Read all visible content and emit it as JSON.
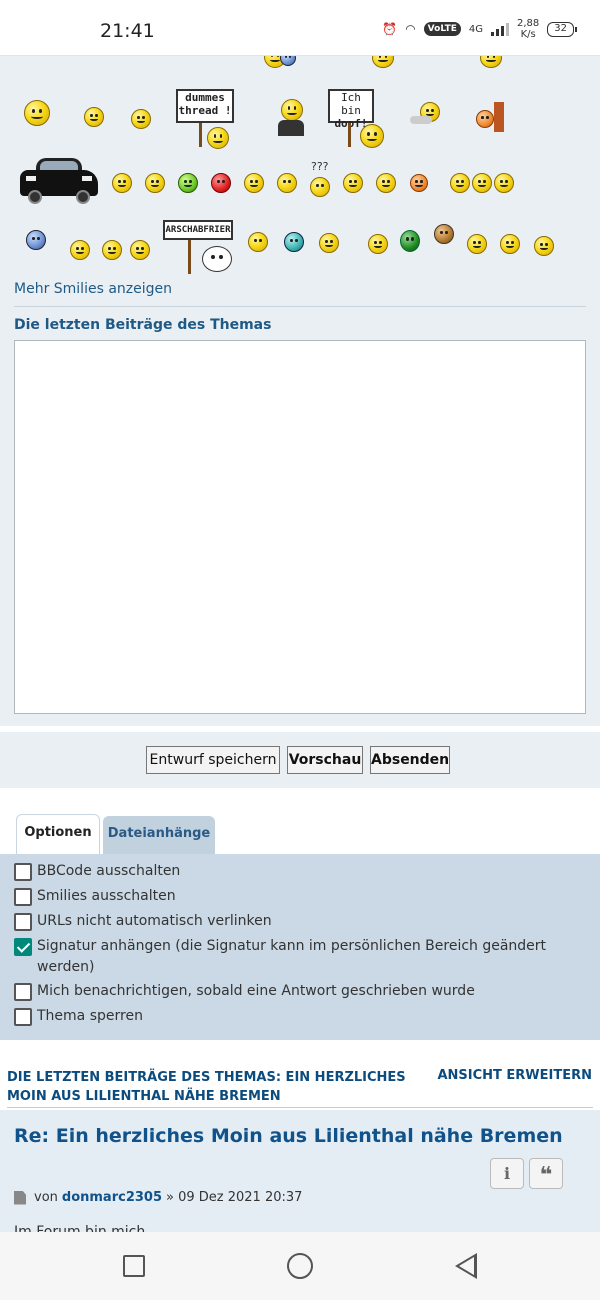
{
  "status_bar": {
    "time": "21:41",
    "network": "4G",
    "volte": "VoLTE",
    "speed_value": "2,88",
    "speed_unit": "K/s",
    "battery": "32"
  },
  "smilies": {
    "signs": {
      "dummes_thread_line1": "dummes",
      "dummes_thread_line2": "thread !",
      "ich_bin_line1": "Ich bin",
      "ich_bin_line2": "doof!",
      "arschabfrier": "ARSCHABFRIER"
    },
    "more_link": "Mehr Smilies anzeigen"
  },
  "topic_review_box": {
    "label": "Die letzten Beiträge des Themas",
    "value": ""
  },
  "buttons": {
    "save_draft": "Entwurf speichern",
    "preview": "Vorschau",
    "submit": "Absenden"
  },
  "tabs": {
    "options": "Optionen",
    "attachments": "Dateianhänge"
  },
  "options": [
    {
      "label": "BBCode ausschalten",
      "checked": false
    },
    {
      "label": "Smilies ausschalten",
      "checked": false
    },
    {
      "label": "URLs nicht automatisch verlinken",
      "checked": false
    },
    {
      "label": "Signatur anhängen (die Signatur kann im persönlichen Bereich geändert werden)",
      "checked": true
    },
    {
      "label": "Mich benachrichtigen, sobald eine Antwort geschrieben wurde",
      "checked": false
    },
    {
      "label": "Thema sperren",
      "checked": false
    }
  ],
  "review": {
    "title": "DIE LETZTEN BEITRÄGE DES THEMAS: EIN HERZLICHES MOIN AUS LILIENTHAL NÄHE BREMEN",
    "expand": "ANSICHT ERWEITERN",
    "post_title": "Re: Ein herzliches Moin aus Lilienthal nähe Bremen",
    "by": "von",
    "author": "donmarc2305",
    "date": "» 09 Dez 2021 20:37",
    "info_btn": "i",
    "quote_btn": "❝",
    "text_cut": "Im Forum bin mich..."
  },
  "colors": {
    "link": "#105289",
    "panel_bg": "#e9eff3",
    "options_bg": "#cad9e5",
    "checkbox_checked": "#00897b"
  }
}
